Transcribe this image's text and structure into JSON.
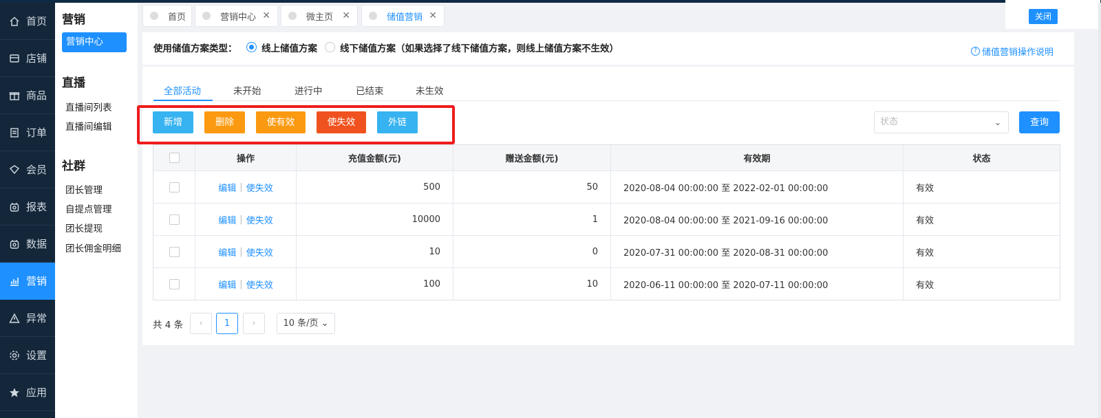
{
  "nav": {
    "items": [
      {
        "label": "首页",
        "icon": "home-icon"
      },
      {
        "label": "店铺",
        "icon": "store-icon"
      },
      {
        "label": "商品",
        "icon": "gift-icon"
      },
      {
        "label": "订单",
        "icon": "order-icon"
      },
      {
        "label": "会员",
        "icon": "member-icon"
      },
      {
        "label": "报表",
        "icon": "report-icon"
      },
      {
        "label": "数据",
        "icon": "data-icon"
      },
      {
        "label": "营销",
        "icon": "chart-icon"
      },
      {
        "label": "异常",
        "icon": "warning-icon"
      },
      {
        "label": "设置",
        "icon": "gear-icon"
      },
      {
        "label": "应用",
        "icon": "star-icon"
      }
    ],
    "active_index": 7
  },
  "submenu": {
    "marketing_title": "营销",
    "marketing_center": "营销中心",
    "live_title": "直播",
    "live_items": [
      "直播间列表",
      "直播间编辑"
    ],
    "community_title": "社群",
    "community_items": [
      "团长管理",
      "自提点管理",
      "团长提现",
      "团长佣金明细"
    ]
  },
  "tabs": [
    {
      "label": "首页",
      "closable": false
    },
    {
      "label": "营销中心",
      "closable": true
    },
    {
      "label": "微主页",
      "closable": true
    },
    {
      "label": "储值营销",
      "closable": true,
      "active": true
    }
  ],
  "close_button": "关闭",
  "scheme": {
    "label": "使用储值方案类型：",
    "online": "线上储值方案",
    "offline": "线下储值方案（如果选择了线下储值方案，则线上储值方案不生效）",
    "selected": "online"
  },
  "help_link": "储值营销操作说明",
  "filter_tabs": [
    "全部活动",
    "未开始",
    "进行中",
    "已结束",
    "未生效"
  ],
  "actions": {
    "add": "新增",
    "delete": "删除",
    "enable": "使有效",
    "disable": "使失效",
    "external_link": "外链"
  },
  "status_select": {
    "placeholder": "状态"
  },
  "query_button": "查询",
  "table": {
    "headers": [
      "操作",
      "充值金额(元)",
      "赠送金额(元)",
      "有效期",
      "状态"
    ],
    "edit_label": "编辑",
    "disable_label": "使失效",
    "sep": "|",
    "rows": [
      {
        "amount": "500",
        "bonus": "50",
        "period": "2020-08-04 00:00:00 至 2022-02-01 00:00:00",
        "status": "有效"
      },
      {
        "amount": "10000",
        "bonus": "1",
        "period": "2020-08-04 00:00:00 至 2021-09-16 00:00:00",
        "status": "有效"
      },
      {
        "amount": "10",
        "bonus": "0",
        "period": "2020-07-31 00:00:00 至 2020-08-31 00:00:00",
        "status": "有效"
      },
      {
        "amount": "100",
        "bonus": "10",
        "period": "2020-06-11 00:00:00 至 2020-07-11 00:00:00",
        "status": "有效"
      }
    ]
  },
  "pagination": {
    "total": "共 4 条",
    "prev": "‹",
    "current": "1",
    "next": "›",
    "page_size": "10 条/页"
  },
  "colors": {
    "primary": "#1e90ff",
    "orange": "#fb9a10",
    "red_orange": "#f0521f",
    "light_blue": "#36b3f0",
    "highlight_box": "#ee1c1c",
    "sidebar": "#14273a"
  }
}
